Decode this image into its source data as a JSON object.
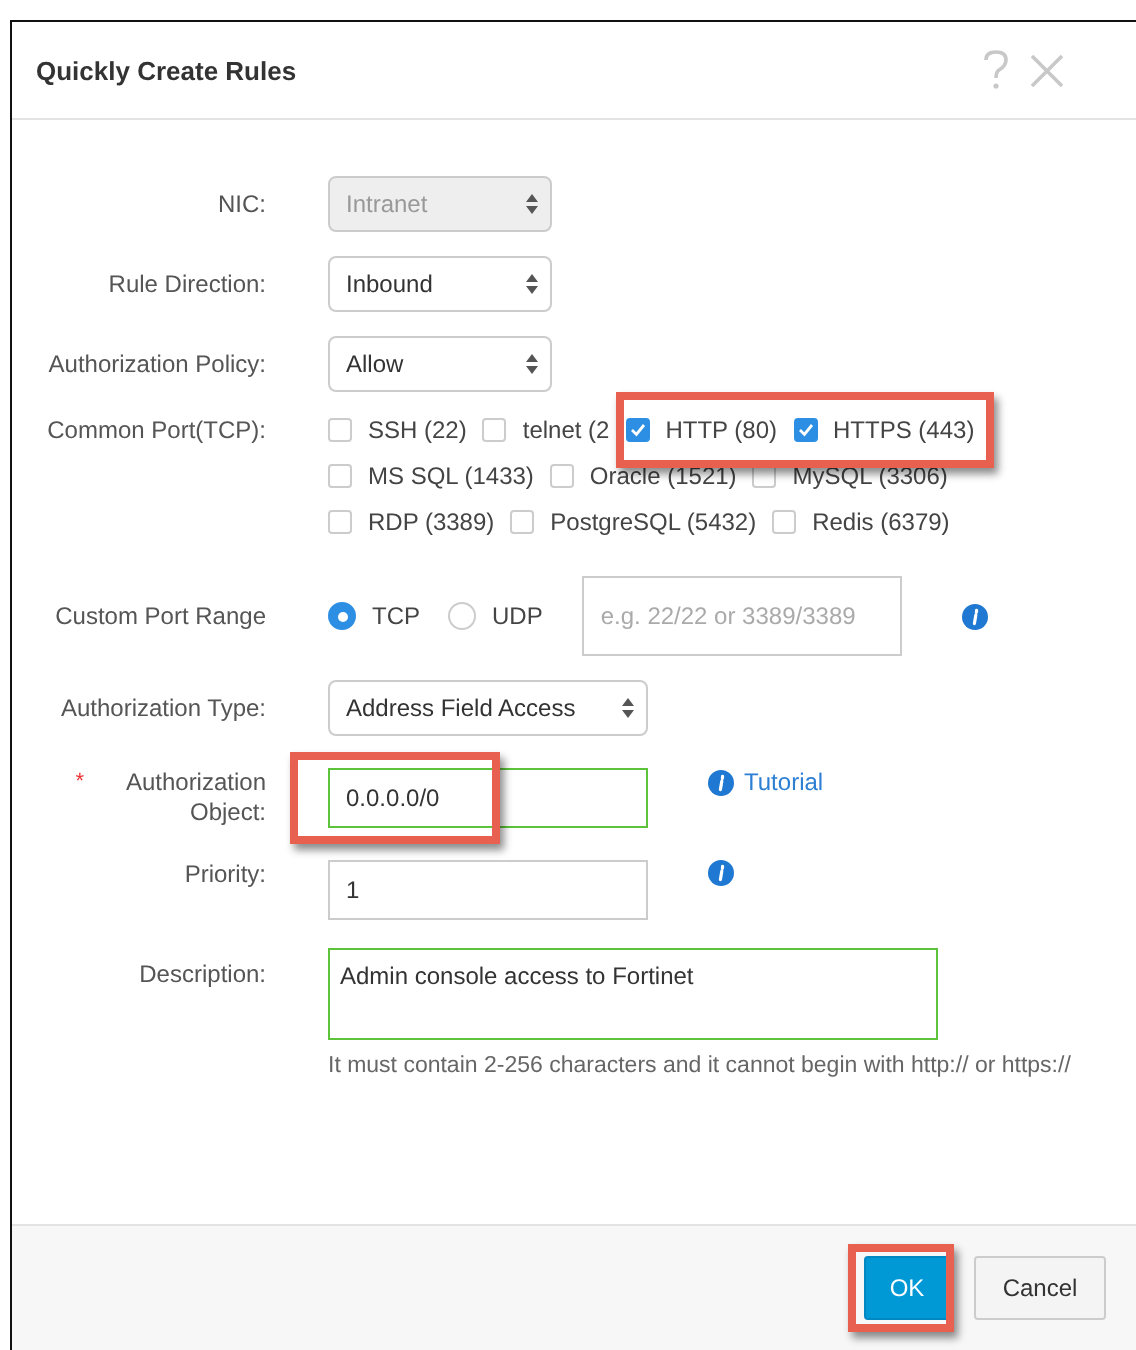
{
  "dialog": {
    "title": "Quickly Create Rules"
  },
  "fields": [
    {
      "kind": "select",
      "label": "NIC:",
      "value": "Intranet",
      "disabled": true
    },
    {
      "kind": "select",
      "label": "Rule Direction:",
      "value": "Inbound",
      "disabled": false
    },
    {
      "kind": "select",
      "label": "Authorization Policy:",
      "value": "Allow",
      "disabled": false
    },
    {
      "kind": "checkboxes",
      "label": "Common Port(TCP):",
      "options": [
        {
          "label": "SSH (22)",
          "checked": false,
          "highlighted": false
        },
        {
          "label": "telnet (2",
          "checked": false,
          "highlighted": false
        },
        {
          "label": "HTTP (80)",
          "checked": true,
          "highlighted": true
        },
        {
          "label": "HTTPS (443)",
          "checked": true,
          "highlighted": true
        },
        {
          "label": "MS SQL (1433)",
          "checked": false,
          "highlighted": false
        },
        {
          "label": "Oracle (1521)",
          "checked": false,
          "highlighted": false
        },
        {
          "label": "MySQL (3306)",
          "checked": false,
          "highlighted": false
        },
        {
          "label": "RDP (3389)",
          "checked": false,
          "highlighted": false
        },
        {
          "label": "PostgreSQL (5432)",
          "checked": false,
          "highlighted": false
        },
        {
          "label": "Redis (6379)",
          "checked": false,
          "highlighted": false
        }
      ]
    },
    {
      "kind": "radios",
      "label": "Custom Port Range",
      "options": [
        {
          "label": "TCP",
          "selected": true
        },
        {
          "label": "UDP",
          "selected": false
        }
      ],
      "placeholder": "e.g. 22/22 or 3389/3389",
      "info": true
    },
    {
      "kind": "select",
      "label": "Authorization Type:",
      "value": "Address Field Access",
      "disabled": false,
      "wide": true
    },
    {
      "kind": "input",
      "label": "Authorization Object:",
      "required_mark": "*",
      "value": "0.0.0.0/0",
      "valid": true,
      "highlighted": true,
      "link": "Tutorial"
    },
    {
      "kind": "input",
      "label": "Priority:",
      "value": "1",
      "valid": false,
      "info": true
    },
    {
      "kind": "textarea",
      "label": "Description:",
      "value": "Admin console access to Fortinet",
      "valid": true,
      "hint": "It must contain 2-256 characters and it cannot begin with http:// or https://"
    }
  ],
  "buttons": [
    {
      "label": "OK",
      "kind": "primary",
      "highlighted": true
    },
    {
      "label": "Cancel",
      "kind": "secondary",
      "highlighted": false
    }
  ]
}
